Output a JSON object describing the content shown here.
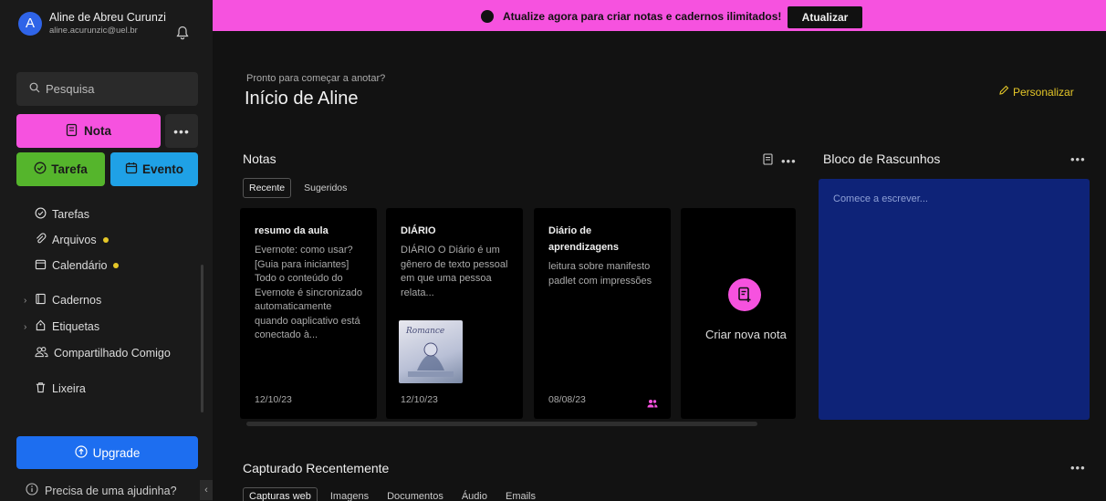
{
  "user": {
    "initial": "A",
    "name": "Aline de Abreu Curunzi",
    "email": "aline.acurunzic@uel.br"
  },
  "search": {
    "placeholder": "Pesquisa"
  },
  "actions": {
    "note": "Nota",
    "more": "•••",
    "task": "Tarefa",
    "event": "Evento"
  },
  "nav": {
    "tasks": "Tarefas",
    "files": "Arquivos",
    "calendar": "Calendário",
    "notebooks": "Cadernos",
    "tags": "Etiquetas",
    "shared": "Compartilhado Comigo",
    "trash": "Lixeira"
  },
  "upgrade": "Upgrade",
  "help": "Precisa de uma ajudinha?",
  "banner": {
    "text": "Atualize agora para criar notas e cadernos ilimitados!",
    "button": "Atualizar"
  },
  "home": {
    "subtitle": "Pronto para começar a anotar?",
    "title": "Início de Aline",
    "customize": "Personalizar"
  },
  "notes": {
    "header": "Notas",
    "more": "•••",
    "tabs": [
      "Recente",
      "Sugeridos"
    ],
    "cards": [
      {
        "title": "resumo da aula",
        "body": "Evernote: como usar? [Guia para iniciantes] Todo o conteúdo do Evernote é sincronizado automaticamente quando oaplicativo está conectado à...",
        "date": "12/10/23"
      },
      {
        "title": "DIÁRIO",
        "body": "DIÁRIO O Diário é um gênero de texto pessoal em que uma pessoa relata...",
        "date": "12/10/23"
      },
      {
        "title": "Diário de aprendizagens",
        "body": "leitura sobre manifesto padlet com impressões",
        "date": "08/08/23"
      }
    ],
    "new_note": "Criar nova nota"
  },
  "scratch": {
    "header": "Bloco de Rascunhos",
    "more": "•••",
    "placeholder": "Comece a escrever..."
  },
  "captured": {
    "header": "Capturado Recentemente",
    "more": "•••",
    "tabs": [
      "Capturas web",
      "Imagens",
      "Documentos",
      "Áudio",
      "Emails"
    ]
  }
}
